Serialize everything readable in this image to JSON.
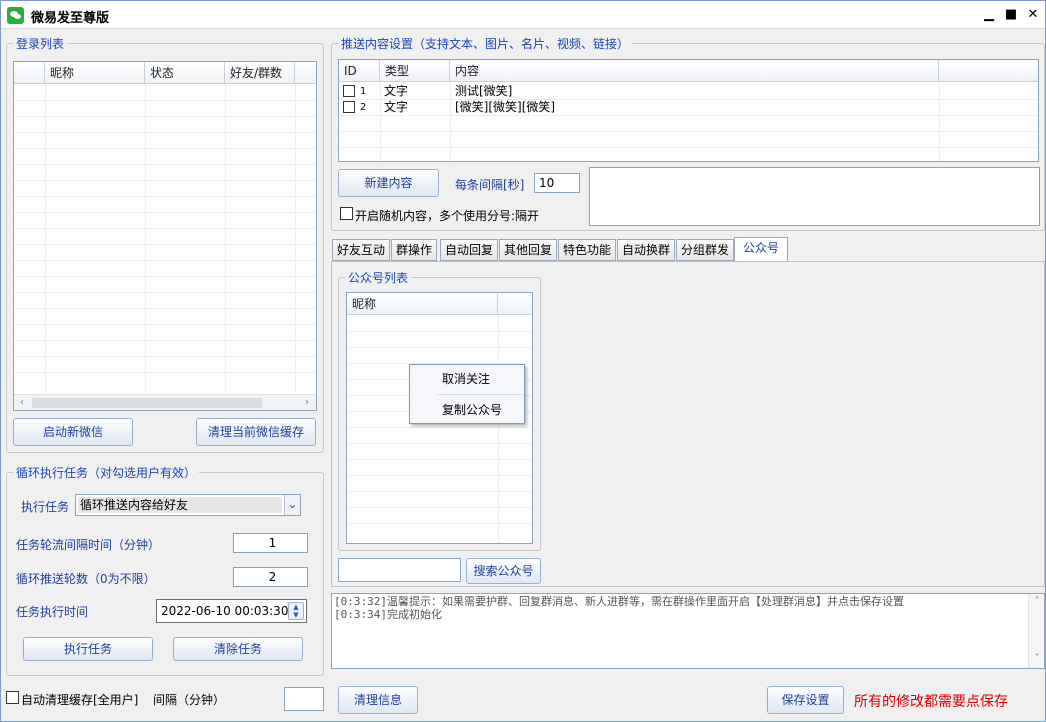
{
  "window": {
    "title": "微易发至尊版"
  },
  "login": {
    "legend": "登录列表",
    "columns": [
      "",
      "昵称",
      "状态",
      "好友/群数"
    ],
    "start_button": "启动新微信",
    "clear_cache_button": "清理当前微信缓存"
  },
  "loop": {
    "legend": "循环执行任务（对勾选用户有效）",
    "task_label": "执行任务",
    "task_value": "循环推送内容给好友",
    "interval_label": "任务轮流间隔时间（分钟）",
    "interval_value": "1",
    "rounds_label": "循环推送轮数（0为不限）",
    "rounds_value": "2",
    "time_label": "任务执行时间",
    "time_value": "2022-06-10 00:03:30",
    "execute_button": "执行任务",
    "clear_button": "清除任务"
  },
  "bottom_left": {
    "auto_clean_label": "自动清理缓存[全用户]",
    "interval_label": "间隔（分钟）",
    "interval_value": ""
  },
  "push": {
    "legend": "推送内容设置（支持文本、图片、名片、视频、链接）",
    "columns": [
      "ID",
      "类型",
      "内容"
    ],
    "rows": [
      {
        "id": "1",
        "type": "文字",
        "content": "测试[微笑]"
      },
      {
        "id": "2",
        "type": "文字",
        "content": "[微笑][微笑][微笑]"
      }
    ],
    "new_button": "新建内容",
    "interval_label": "每条间隔[秒]",
    "interval_value": "10",
    "random_label": "开启随机内容，多个使用分号:隔开"
  },
  "tabs": [
    "好友互动",
    "群操作",
    "自动回复",
    "其他回复",
    "特色功能",
    "自动换群",
    "分组群发",
    "公众号"
  ],
  "official": {
    "legend": "公众号列表",
    "column": "昵称",
    "search_placeholder": "",
    "search_button": "搜索公众号"
  },
  "context_menu": [
    "取消关注",
    "复制公众号"
  ],
  "log": [
    "[0:3:32]温馨提示：如果需要护群、回复群消息、新人进群等，需在群操作里面开启【处理群消息】并点击保存设置",
    "[0:3:34]完成初始化"
  ],
  "footer": {
    "clear_info_button": "清理信息",
    "save_button": "保存设置",
    "note": "所有的修改都需要点保存",
    "note_color": "#e00000"
  }
}
